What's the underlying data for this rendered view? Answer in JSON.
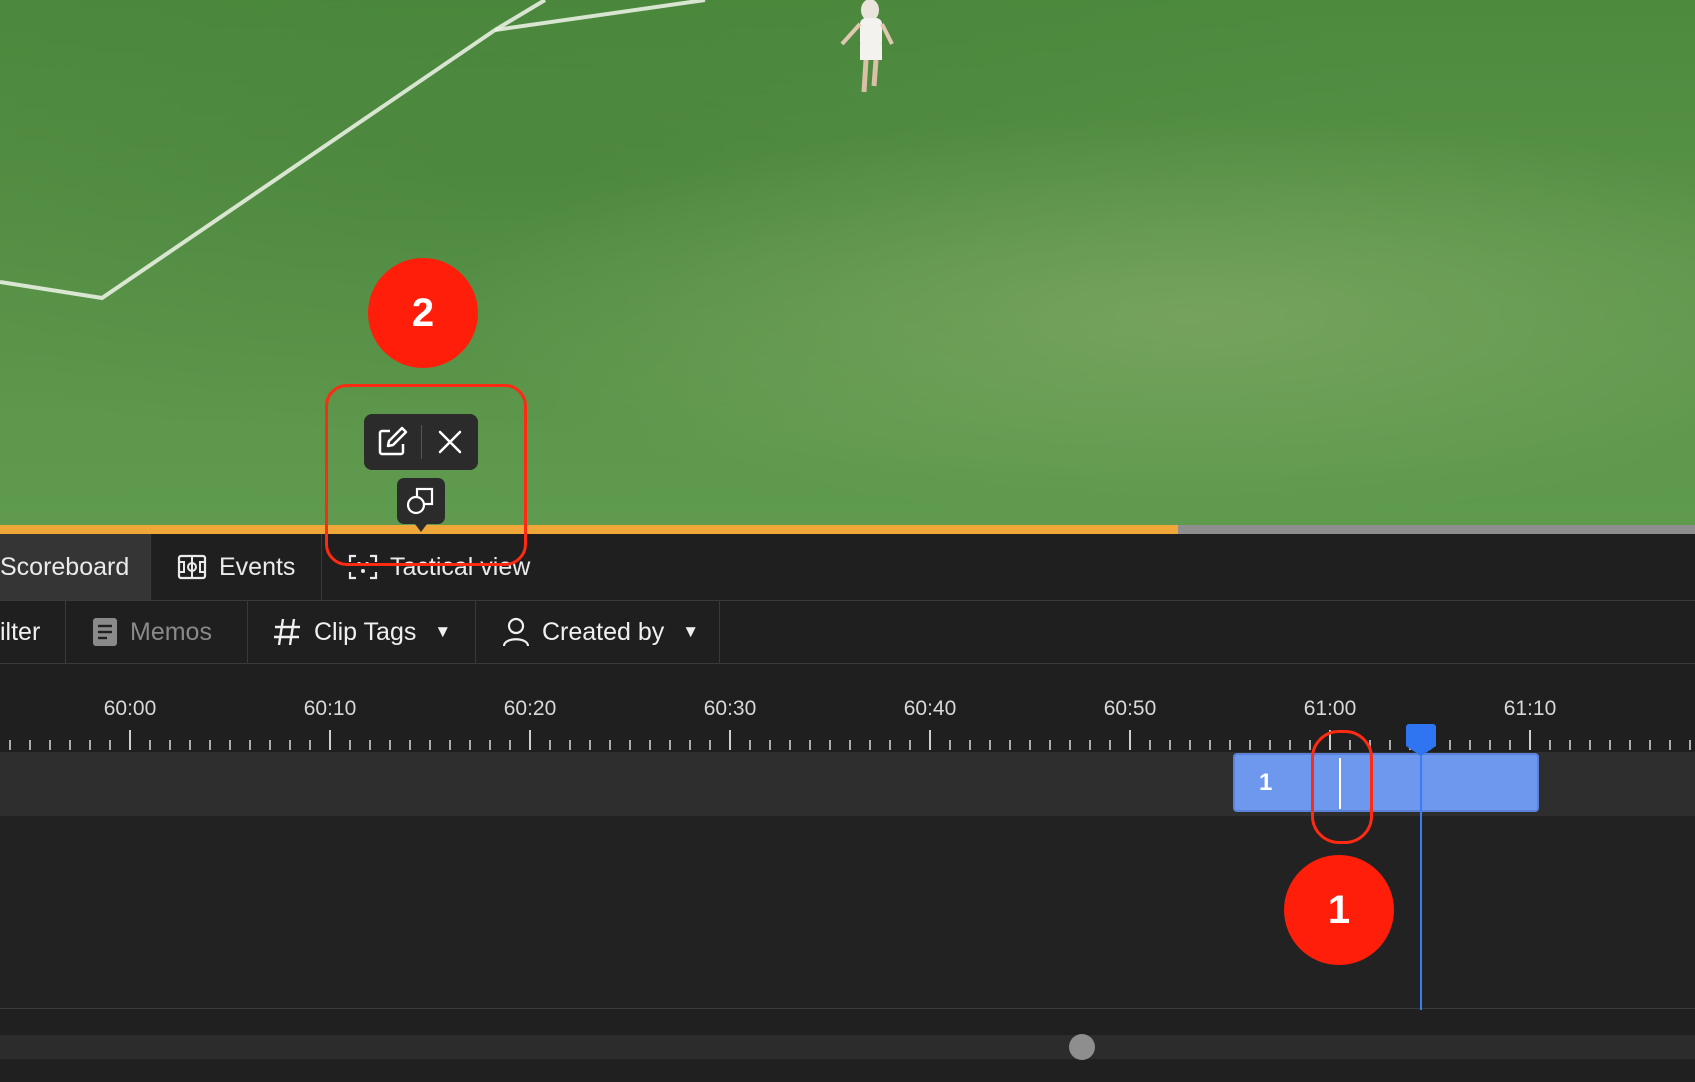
{
  "tabs": [
    {
      "label": "Scoreboard",
      "icon": "scoreboard-icon",
      "active": true
    },
    {
      "label": "Events",
      "icon": "pitch-icon",
      "active": false
    },
    {
      "label": "Tactical view",
      "icon": "tactical-view-icon",
      "active": false
    }
  ],
  "filters": {
    "filter_label": "ilter",
    "memos_label": "Memos",
    "clip_tags_label": "Clip Tags",
    "created_by_label": "Created by"
  },
  "timeline": {
    "ticks": [
      "60:00",
      "60:10",
      "60:20",
      "60:30",
      "60:40",
      "60:50",
      "61:00",
      "61:10"
    ],
    "clip_label": "1",
    "playback_progress": 0.695
  },
  "popup": {
    "edit_icon": "edit-icon",
    "close_icon": "close-icon",
    "marker_icon": "shapes-icon"
  },
  "annotations": {
    "circle_1": "1",
    "circle_2": "2"
  },
  "colors": {
    "accent_blue": "#2f74f0",
    "clip_blue": "#6e97ee",
    "progress_orange": "#f0a73a",
    "annotation_red": "#ff1e0a"
  }
}
